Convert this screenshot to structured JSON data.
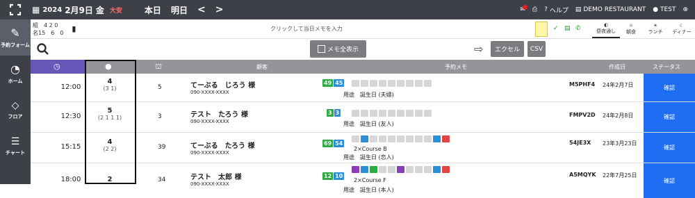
{
  "header": {
    "year": "2024",
    "date": "2月9日",
    "weekday": "金",
    "rokuyo": "大安",
    "today": "本日",
    "tomorrow": "明日",
    "prev": "〈",
    "next": "〉",
    "help": "ヘルプ",
    "restaurant": "DEMO RESTAURANT",
    "user": "TEST"
  },
  "sidebar": {
    "items": [
      {
        "label": "予約フォーム"
      },
      {
        "label": "ホーム"
      },
      {
        "label": "フロア"
      },
      {
        "label": "チャート"
      }
    ]
  },
  "counts": {
    "line1": "組　4  2  0",
    "line2": "名15　6　0"
  },
  "memo_placeholder": "クリックして当日メモを入力",
  "toolbar": {
    "hirumaku": "昼夜通し",
    "asa": "朝食",
    "lunch": "ランチ",
    "dinner": "ディナー"
  },
  "actions": {
    "memo_all": "メモ全表示",
    "excel": "エクセル",
    "csv": "CSV"
  },
  "columns": {
    "customer": "顧客",
    "memo": "予約メモ",
    "created": "作成日",
    "status": "ステータス"
  },
  "rows": [
    {
      "time": "12:00",
      "pax": "4",
      "sub": "(3 1)",
      "table": "5",
      "name": "てーぶる　じろう 様",
      "phone": "090-XXXX-XXXX",
      "t1": "49",
      "t2": "45",
      "course": "",
      "memo": "用途　誕生日 (夫婦)",
      "code": "M5PHF4",
      "created": "24年2月7日",
      "status": "確認"
    },
    {
      "time": "12:30",
      "pax": "5",
      "sub": "(2 1 1 1)",
      "table": "3",
      "name": "テスト　たろう 様",
      "phone": "090-XXXX-XXXX",
      "t1": "3",
      "t2": "3",
      "course": "",
      "memo": "用途　誕生日 (友人)",
      "code": "FMPV2D",
      "created": "24年2月8日",
      "status": "確認"
    },
    {
      "time": "15:15",
      "pax": "4",
      "sub": "(2 2)",
      "table": "39",
      "name": "てーぶる　たろう 様",
      "phone": "090-XXXX-XXXX",
      "t1": "69",
      "t2": "54",
      "course": "2×Course B",
      "memo": "用途　誕生日 (恋人)",
      "code": "54JE3X",
      "created": "23年3月23日",
      "status": "確認"
    },
    {
      "time": "18:00",
      "pax": "2",
      "sub": "",
      "table": "34",
      "name": "テスト　太郎 様",
      "phone": "090-XXXX-XXXX",
      "t1": "12",
      "t2": "10",
      "course": "2×Course F",
      "memo": "用途　誕生日 (本人)",
      "code": "A5MQYK",
      "created": "22年7月25日",
      "status": "確認"
    }
  ]
}
